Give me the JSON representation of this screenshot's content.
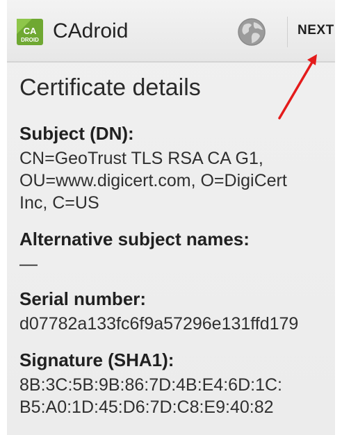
{
  "action_bar": {
    "app_icon_text_top": "CA",
    "app_icon_text_bottom": "DROID",
    "app_title": "CAdroid",
    "globe_icon": "globe-icon",
    "next_label": "NEXT"
  },
  "colors": {
    "icon_green": "#6fa832",
    "annotation_arrow": "#e41b1b"
  },
  "main": {
    "title": "Certificate details",
    "sections": [
      {
        "label": "Subject (DN):",
        "value": "CN=GeoTrust TLS RSA CA G1,\nOU=www.digicert.com, O=DigiCert\nInc, C=US"
      },
      {
        "label": "Alternative subject names:",
        "value": "—"
      },
      {
        "label": "Serial number:",
        "value": "d07782a133fc6f9a57296e131ffd179"
      },
      {
        "label": "Signature (SHA1):",
        "value": "8B:3C:5B:9B:86:7D:4B:E4:6D:1C:\nB5:A0:1D:45:D6:7D:C8:E9:40:82"
      }
    ]
  }
}
